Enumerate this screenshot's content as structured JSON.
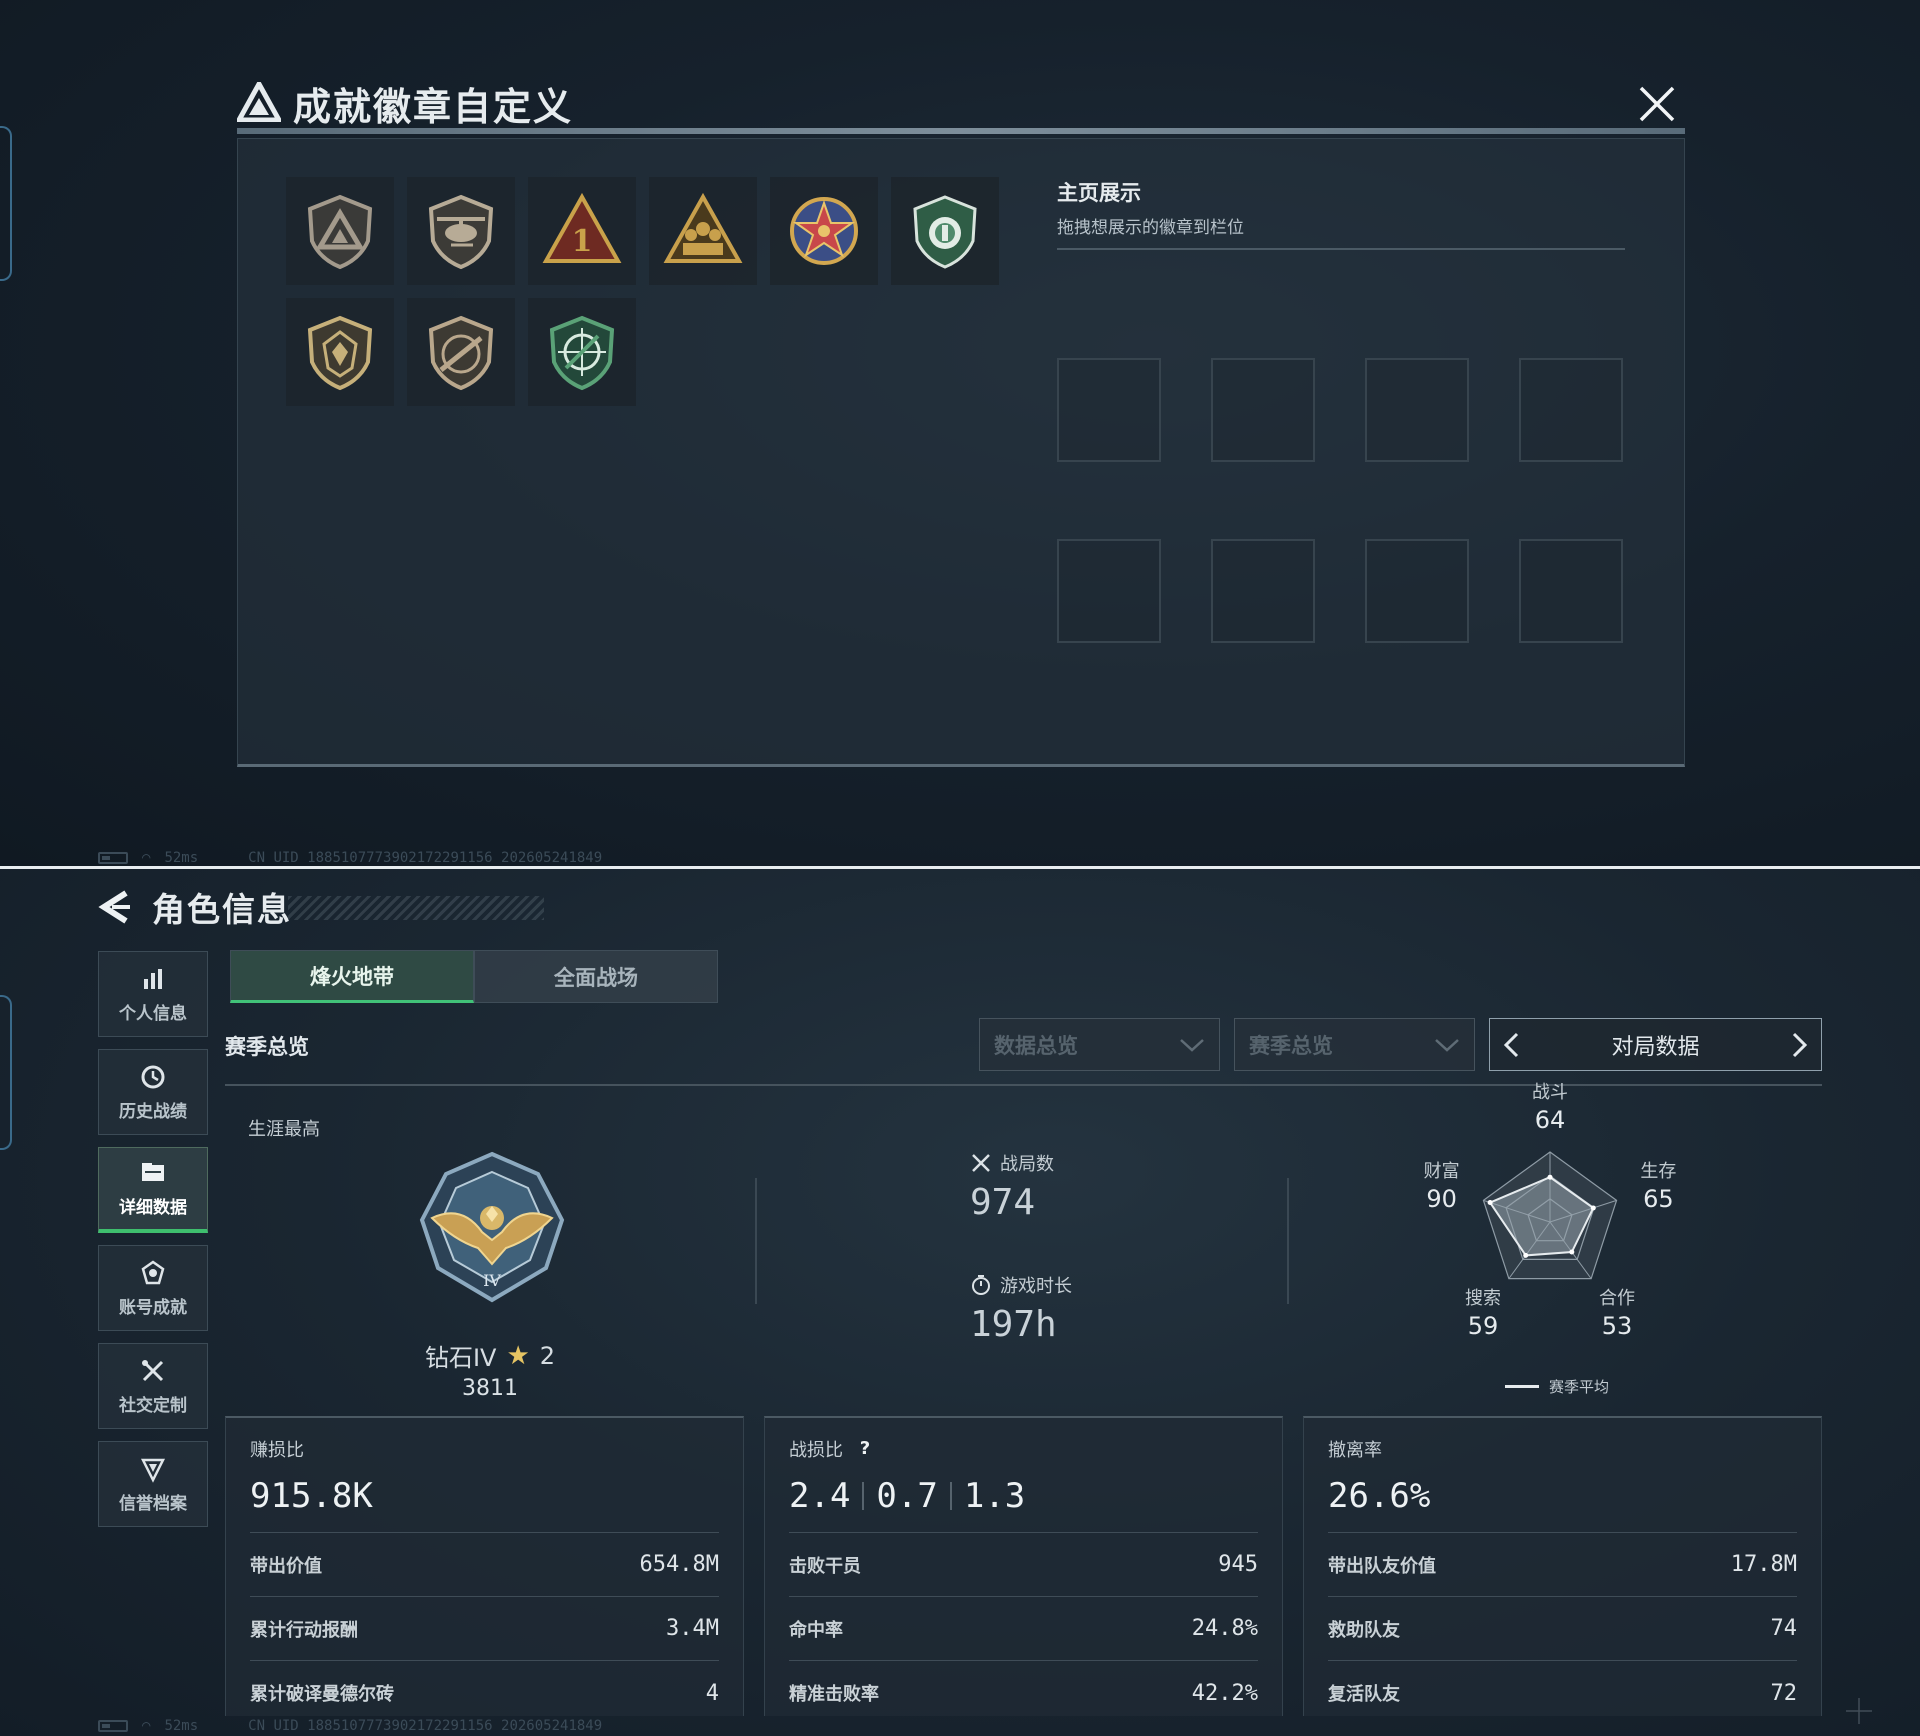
{
  "top": {
    "modal": {
      "title": "成就徽章自定义",
      "badges": [
        {
          "icon": "triangle-emblem-icon",
          "color": "#a39a8c"
        },
        {
          "icon": "helicopter-emblem-icon",
          "color": "#b7ab96"
        },
        {
          "icon": "rank-one-emblem-icon",
          "color": "#c9a24a"
        },
        {
          "icon": "squad-emblem-icon",
          "color": "#c8a04c"
        },
        {
          "icon": "star-medal-icon",
          "color": "#c8474a"
        },
        {
          "icon": "green-shield-icon",
          "color": "#4f8a6c"
        },
        {
          "icon": "wolf-shield-icon",
          "color": "#c6b07a"
        },
        {
          "icon": "rifle-shield-icon",
          "color": "#b9a78c"
        },
        {
          "icon": "green-crosshair-icon",
          "color": "#5aa277"
        }
      ],
      "showcase": {
        "title": "主页展示",
        "subtitle": "拖拽想展示的徽章到栏位",
        "slot_count": 8
      }
    },
    "status": {
      "ping": "52ms",
      "uid": "CN UID 1885107773902172291156 202605241849"
    }
  },
  "bottom": {
    "page_title": "角色信息",
    "nav": [
      {
        "label": "个人信息",
        "icon": "bar-chart-icon",
        "active": false
      },
      {
        "label": "历史战绩",
        "icon": "history-clock-icon",
        "active": false
      },
      {
        "label": "详细数据",
        "icon": "folder-icon",
        "active": true
      },
      {
        "label": "账号成就",
        "icon": "achievement-icon",
        "active": false
      },
      {
        "label": "社交定制",
        "icon": "tools-icon",
        "active": false
      },
      {
        "label": "信誉档案",
        "icon": "reputation-icon",
        "active": false
      }
    ],
    "mode_tabs": [
      {
        "label": "烽火地带",
        "active": true
      },
      {
        "label": "全面战场",
        "active": false
      }
    ],
    "section_title": "赛季总览",
    "filters": {
      "data_overview": "数据总览",
      "season_overview": "赛季总览",
      "pager_label": "对局数据"
    },
    "career": {
      "label": "生涯最高",
      "rank_name": "钻石IV",
      "stars": "2",
      "score": "3811"
    },
    "stats": {
      "matches_label": "战局数",
      "matches_value": "974",
      "playtime_label": "游戏时长",
      "playtime_value": "197h"
    },
    "radar": {
      "axes": [
        {
          "name": "战斗",
          "value": 64
        },
        {
          "name": "生存",
          "value": 65
        },
        {
          "name": "合作",
          "value": 53
        },
        {
          "name": "搜索",
          "value": 59
        },
        {
          "name": "财富",
          "value": 90
        }
      ],
      "legend": "赛季平均"
    },
    "panels": [
      {
        "title": "赚损比",
        "main": "915.8K",
        "rows": [
          {
            "k": "带出价值",
            "v": "654.8M"
          },
          {
            "k": "累计行动报酬",
            "v": "3.4M"
          },
          {
            "k": "累计破译曼德尔砖",
            "v": "4"
          }
        ]
      },
      {
        "title": "战损比",
        "help": "?",
        "main_parts": [
          "2.4",
          "0.7",
          "1.3"
        ],
        "rows": [
          {
            "k": "击败干员",
            "v": "945"
          },
          {
            "k": "命中率",
            "v": "24.8%"
          },
          {
            "k": "精准击败率",
            "v": "42.2%"
          }
        ]
      },
      {
        "title": "撤离率",
        "main": "26.6%",
        "rows": [
          {
            "k": "带出队友价值",
            "v": "17.8M"
          },
          {
            "k": "救助队友",
            "v": "74"
          },
          {
            "k": "复活队友",
            "v": "72"
          }
        ]
      }
    ],
    "status": {
      "ping": "52ms",
      "uid": "CN UID 1885107773902172291156 202605241849"
    }
  },
  "colors": {
    "accent_green": "#41c278",
    "star_gold": "#e5c463"
  }
}
